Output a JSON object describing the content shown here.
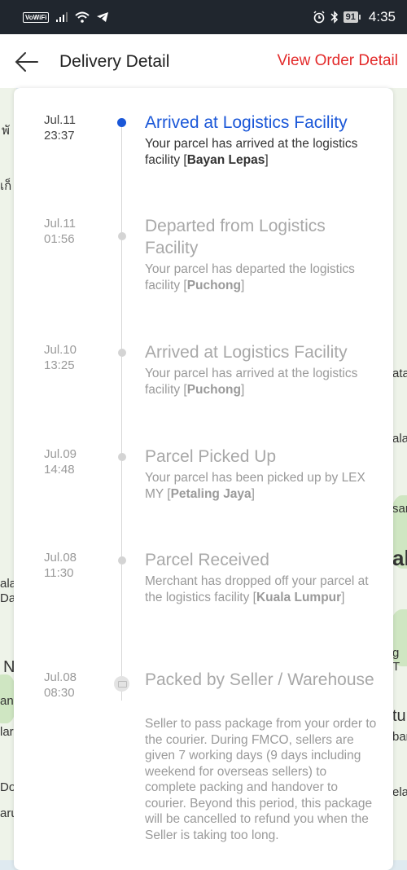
{
  "status_bar": {
    "wifi_badge": "VoWiFi",
    "battery": "91",
    "time": "4:35",
    "icons": [
      "signal-icon",
      "wifi-icon",
      "telegram-icon",
      "alarm-icon",
      "bluetooth-icon",
      "battery-icon"
    ]
  },
  "header": {
    "title": "Delivery Detail",
    "view_order": "View Order Detail",
    "accent_color": "#e32b2b"
  },
  "map_labels": [
    "พั",
    "เก็",
    "ata",
    "ala",
    "san",
    "al",
    "ala",
    "Dar",
    "g T",
    "N",
    "ang",
    "lar",
    "tur",
    "ban",
    "Do",
    "ela",
    "aru"
  ],
  "events": [
    {
      "date": "Jul.11",
      "time": "23:37",
      "title": "Arrived at Logistics Facility",
      "desc_prefix": "Your parcel has arrived at the logistics facility [",
      "desc_bold": "Bayan Lepas",
      "desc_suffix": "]",
      "active": true
    },
    {
      "date": "Jul.11",
      "time": "01:56",
      "title": "Departed from Logistics Facility",
      "desc_prefix": "Your parcel has departed the logistics facility [",
      "desc_bold": "Puchong",
      "desc_suffix": "]"
    },
    {
      "date": "Jul.10",
      "time": "13:25",
      "title": "Arrived at Logistics Facility",
      "desc_prefix": "Your parcel has arrived at the logistics facility [",
      "desc_bold": "Puchong",
      "desc_suffix": "]"
    },
    {
      "date": "Jul.09",
      "time": "14:48",
      "title": "Parcel Picked Up",
      "desc_prefix": "Your parcel has been picked up by LEX MY [",
      "desc_bold": "Petaling Jaya",
      "desc_suffix": "]"
    },
    {
      "date": "Jul.08",
      "time": "11:30",
      "title": "Parcel Received",
      "desc_prefix": "Merchant has dropped off your parcel at the logistics facility [",
      "desc_bold": "Kuala Lumpur",
      "desc_suffix": "]"
    },
    {
      "date": "Jul.08",
      "time": "08:30",
      "title": "Packed by Seller / Warehouse",
      "desc_prefix": "Seller to pass package from your order to the courier. During FMCO, sellers are given 7 working days (9 days including weekend for overseas sellers) to complete packing and handover to courier. Beyond this period, this package will be cancelled to refund you when the Seller is taking too long.",
      "desc_bold": "",
      "desc_suffix": ""
    }
  ],
  "colors": {
    "active": "#1a57d8",
    "inactive": "#a8a8a8",
    "status_bar": "#20262e"
  }
}
